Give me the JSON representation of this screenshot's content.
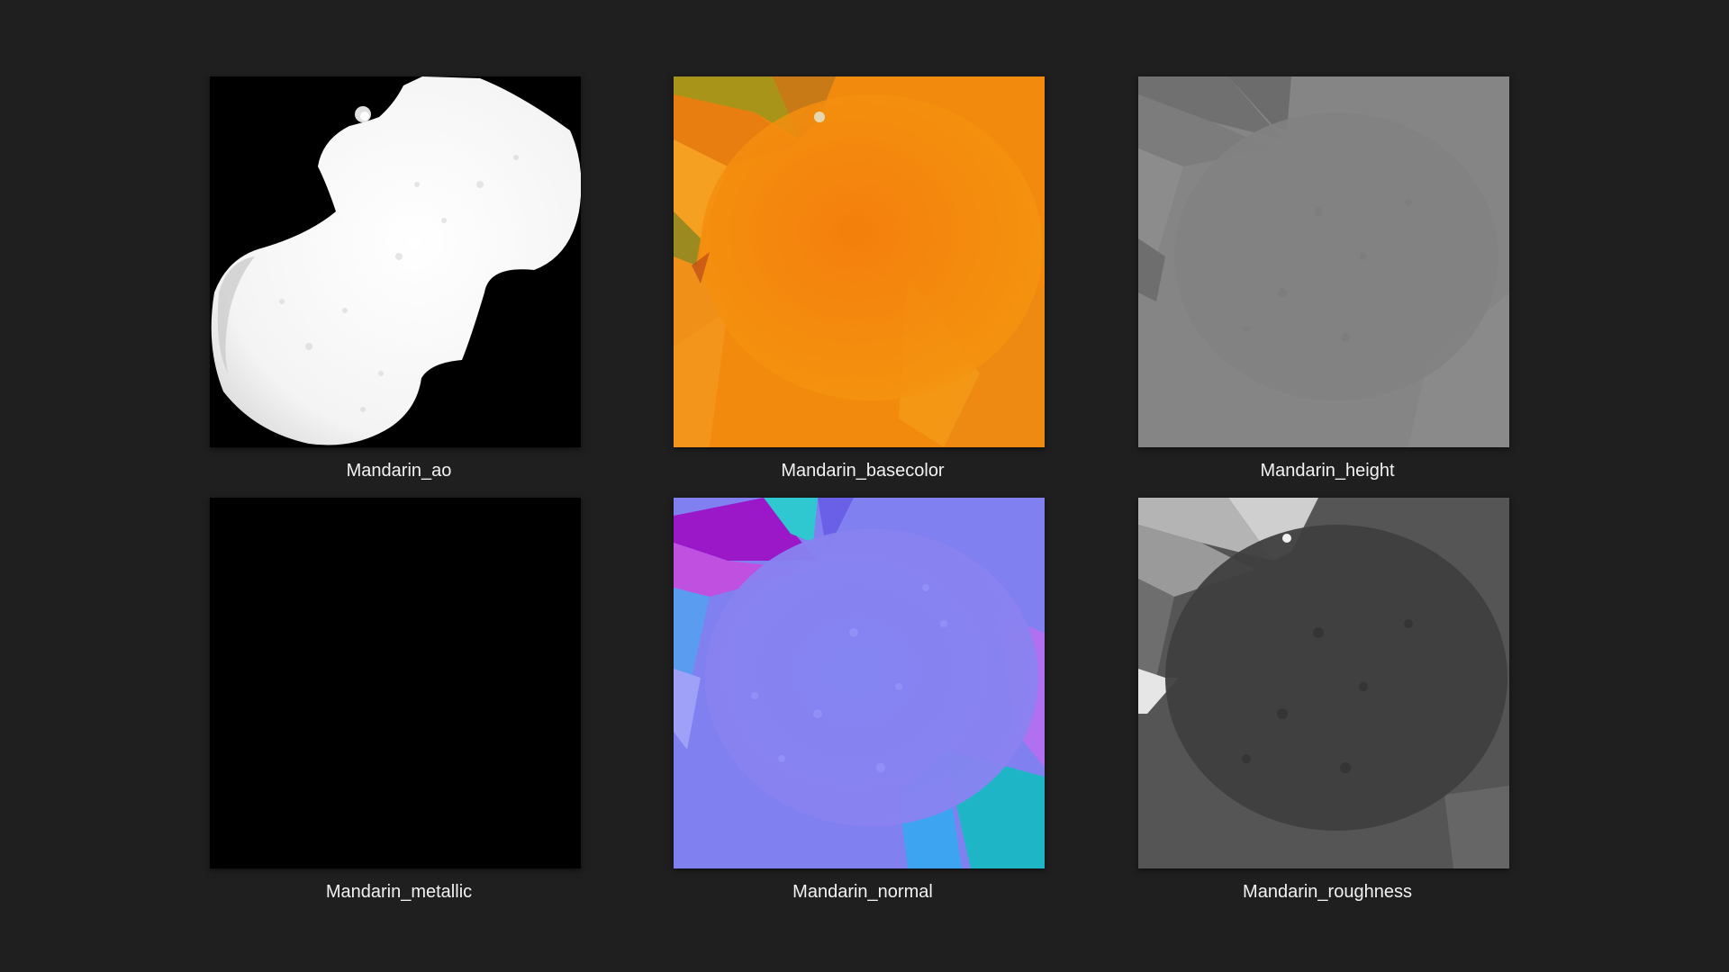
{
  "files": [
    {
      "name": "Mandarin_ao",
      "icon": "ao-map-thumbnail",
      "kind": "ao"
    },
    {
      "name": "Mandarin_basecolor",
      "icon": "basecolor-map-thumbnail",
      "kind": "basecolor"
    },
    {
      "name": "Mandarin_height",
      "icon": "height-map-thumbnail",
      "kind": "height"
    },
    {
      "name": "Mandarin_metallic",
      "icon": "metallic-map-thumbnail",
      "kind": "metallic"
    },
    {
      "name": "Mandarin_normal",
      "icon": "normal-map-thumbnail",
      "kind": "normal"
    },
    {
      "name": "Mandarin_roughness",
      "icon": "roughness-map-thumbnail",
      "kind": "roughness"
    }
  ],
  "colors": {
    "background": "#1f1f1f",
    "caption_text": "#f2f2f2",
    "basecolor_orange": "#f28a0e",
    "normal_violet": "#8282f0",
    "normal_cyan": "#1fb4c4",
    "height_gray": "#858585",
    "roughness_gray": "#454545",
    "metallic_black": "#000000"
  }
}
